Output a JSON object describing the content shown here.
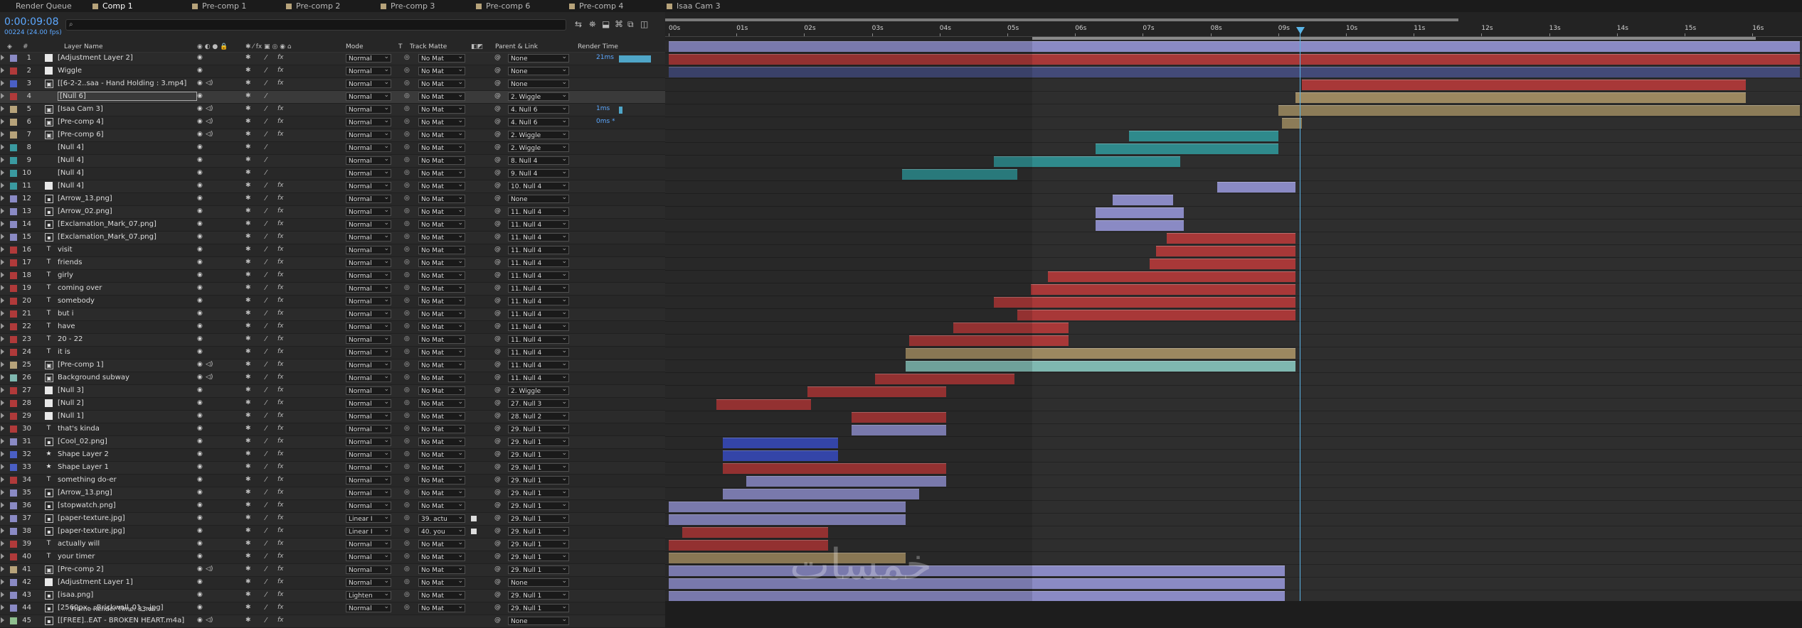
{
  "tabs": [
    {
      "label": "Render Queue",
      "color": "",
      "active": false
    },
    {
      "label": "Comp 1",
      "color": "#b7a37a",
      "active": true
    },
    {
      "label": "Pre-comp 1",
      "color": "#b7a37a",
      "active": false
    },
    {
      "label": "Pre-comp 2",
      "color": "#b7a37a",
      "active": false
    },
    {
      "label": "Pre-comp 3",
      "color": "#b7a37a",
      "active": false
    },
    {
      "label": "Pre-comp 6",
      "color": "#b7a37a",
      "active": false
    },
    {
      "label": "Pre-comp 4",
      "color": "#b7a37a",
      "active": false
    },
    {
      "label": "Isaa Cam 3",
      "color": "#b7a37a",
      "active": false
    }
  ],
  "timecode": "0:00:09:08",
  "frame_info": "00224 (24.00 fps)",
  "search": {
    "placeholder": "",
    "icon": "search-icon"
  },
  "columns": {
    "layer_name": "Layer Name",
    "mode": "Mode",
    "t": "T",
    "track_matte": "Track Matte",
    "parent": "Parent & Link",
    "render_time": "Render Time"
  },
  "ruler": [
    "00s",
    "01s",
    "02s",
    "03s",
    "04s",
    "05s",
    "06s",
    "07s",
    "08s",
    "09s",
    "10s",
    "11s",
    "12s",
    "13s",
    "14s",
    "15s",
    "16s"
  ],
  "layers": [
    {
      "n": "1",
      "color": "#8a8ac4",
      "type": "solid",
      "name": "[Adjustment Layer 2]",
      "mode": "Normal",
      "matte": "No Mat",
      "parent": "None",
      "rt": "21ms",
      "rtbar": 0.1
    },
    {
      "n": "2",
      "color": "#b03a3a",
      "type": "solid",
      "name": "Wiggle",
      "mode": "Normal",
      "matte": "No Mat",
      "parent": "None"
    },
    {
      "n": "3",
      "color": "#4a5fc4",
      "type": "comp",
      "name": "[[6-2-2..saa - Hand Holding : 3.mp4]",
      "mode": "Normal",
      "matte": "No Mat",
      "parent": "None"
    },
    {
      "n": "4",
      "color": "#b03a3a",
      "type": "none",
      "name": "[Null 6]",
      "mode": "Normal",
      "matte": "No Mat",
      "parent": "2. Wiggle",
      "selected": true
    },
    {
      "n": "5",
      "color": "#b7a37a",
      "type": "comp",
      "name": "[Isaa Cam 3]",
      "mode": "Normal",
      "matte": "No Mat",
      "parent": "4. Null 6",
      "rt": "1ms",
      "rtbar": 0.01
    },
    {
      "n": "6",
      "color": "#b7a37a",
      "type": "comp",
      "name": "[Pre-comp 4]",
      "mode": "Normal",
      "matte": "No Mat",
      "parent": "4. Null 6",
      "rt": "0ms *"
    },
    {
      "n": "7",
      "color": "#b7a37a",
      "type": "comp",
      "name": "[Pre-comp 6]",
      "mode": "Normal",
      "matte": "No Mat",
      "parent": "2. Wiggle"
    },
    {
      "n": "8",
      "color": "#3a9aa0",
      "type": "none",
      "name": "[Null 4]",
      "mode": "Normal",
      "matte": "No Mat",
      "parent": "2. Wiggle"
    },
    {
      "n": "9",
      "color": "#3a9aa0",
      "type": "none",
      "name": "[Null 4]",
      "mode": "Normal",
      "matte": "No Mat",
      "parent": "8. Null 4"
    },
    {
      "n": "10",
      "color": "#3a9aa0",
      "type": "none",
      "name": "[Null 4]",
      "mode": "Normal",
      "matte": "No Mat",
      "parent": "9. Null 4"
    },
    {
      "n": "11",
      "color": "#3a9aa0",
      "type": "solid",
      "name": "[Null 4]",
      "mode": "Normal",
      "matte": "No Mat",
      "parent": "10. Null 4"
    },
    {
      "n": "12",
      "color": "#8a8ac4",
      "type": "file",
      "name": "[Arrow_13.png]",
      "mode": "Normal",
      "matte": "No Mat",
      "parent": "None"
    },
    {
      "n": "13",
      "color": "#8a8ac4",
      "type": "file",
      "name": "[Arrow_02.png]",
      "mode": "Normal",
      "matte": "No Mat",
      "parent": "11. Null 4"
    },
    {
      "n": "14",
      "color": "#8a8ac4",
      "type": "file",
      "name": "[Exclamation_Mark_07.png]",
      "mode": "Normal",
      "matte": "No Mat",
      "parent": "11. Null 4"
    },
    {
      "n": "15",
      "color": "#8a8ac4",
      "type": "file",
      "name": "[Exclamation_Mark_07.png]",
      "mode": "Normal",
      "matte": "No Mat",
      "parent": "11. Null 4"
    },
    {
      "n": "16",
      "color": "#b03a3a",
      "type": "text",
      "name": "visit",
      "mode": "Normal",
      "matte": "No Mat",
      "parent": "11. Null 4"
    },
    {
      "n": "17",
      "color": "#b03a3a",
      "type": "text",
      "name": "friends",
      "mode": "Normal",
      "matte": "No Mat",
      "parent": "11. Null 4"
    },
    {
      "n": "18",
      "color": "#b03a3a",
      "type": "text",
      "name": "girly",
      "mode": "Normal",
      "matte": "No Mat",
      "parent": "11. Null 4"
    },
    {
      "n": "19",
      "color": "#b03a3a",
      "type": "text",
      "name": "coming over",
      "mode": "Normal",
      "matte": "No Mat",
      "parent": "11. Null 4"
    },
    {
      "n": "20",
      "color": "#b03a3a",
      "type": "text",
      "name": "somebody",
      "mode": "Normal",
      "matte": "No Mat",
      "parent": "11. Null 4"
    },
    {
      "n": "21",
      "color": "#b03a3a",
      "type": "text",
      "name": "but i",
      "mode": "Normal",
      "matte": "No Mat",
      "parent": "11. Null 4"
    },
    {
      "n": "22",
      "color": "#b03a3a",
      "type": "text",
      "name": "have",
      "mode": "Normal",
      "matte": "No Mat",
      "parent": "11. Null 4"
    },
    {
      "n": "23",
      "color": "#b03a3a",
      "type": "text",
      "name": "20 - 22",
      "mode": "Normal",
      "matte": "No Mat",
      "parent": "11. Null 4"
    },
    {
      "n": "24",
      "color": "#b03a3a",
      "type": "text",
      "name": "it is",
      "mode": "Normal",
      "matte": "No Mat",
      "parent": "11. Null 4"
    },
    {
      "n": "25",
      "color": "#b7a37a",
      "type": "comp",
      "name": "[Pre-comp 1]",
      "mode": "Normal",
      "matte": "No Mat",
      "parent": "11. Null 4"
    },
    {
      "n": "26",
      "color": "#7fb8b0",
      "type": "comp",
      "name": "Background subway",
      "mode": "Normal",
      "matte": "No Mat",
      "parent": "11. Null 4"
    },
    {
      "n": "27",
      "color": "#b03a3a",
      "type": "solid",
      "name": "[Null 3]",
      "mode": "Normal",
      "matte": "No Mat",
      "parent": "2. Wiggle"
    },
    {
      "n": "28",
      "color": "#b03a3a",
      "type": "solid",
      "name": "[Null 2]",
      "mode": "Normal",
      "matte": "No Mat",
      "parent": "27. Null 3"
    },
    {
      "n": "29",
      "color": "#b03a3a",
      "type": "solid",
      "name": "[Null 1]",
      "mode": "Normal",
      "matte": "No Mat",
      "parent": "28. Null 2"
    },
    {
      "n": "30",
      "color": "#b03a3a",
      "type": "text",
      "name": "that's kinda",
      "mode": "Normal",
      "matte": "No Mat",
      "parent": "29. Null 1"
    },
    {
      "n": "31",
      "color": "#8a8ac4",
      "type": "file",
      "name": "[Cool_02.png]",
      "mode": "Normal",
      "matte": "No Mat",
      "parent": "29. Null 1"
    },
    {
      "n": "32",
      "color": "#4a5fc4",
      "type": "shape",
      "name": "Shape Layer 2",
      "mode": "Normal",
      "matte": "No Mat",
      "parent": "29. Null 1"
    },
    {
      "n": "33",
      "color": "#4a5fc4",
      "type": "shape",
      "name": "Shape Layer 1",
      "mode": "Normal",
      "matte": "No Mat",
      "parent": "29. Null 1"
    },
    {
      "n": "34",
      "color": "#b03a3a",
      "type": "text",
      "name": "something do-er",
      "mode": "Normal",
      "matte": "No Mat",
      "parent": "29. Null 1"
    },
    {
      "n": "35",
      "color": "#8a8ac4",
      "type": "file",
      "name": "[Arrow_13.png]",
      "mode": "Normal",
      "matte": "No Mat",
      "parent": "29. Null 1"
    },
    {
      "n": "36",
      "color": "#8a8ac4",
      "type": "file",
      "name": "[stopwatch.png]",
      "mode": "Normal",
      "matte": "No Mat",
      "parent": "29. Null 1"
    },
    {
      "n": "37",
      "color": "#8a8ac4",
      "type": "file",
      "name": "[paper-texture.jpg]",
      "mode": "Linear I",
      "matte": "39. actu",
      "parent": "29. Null 1",
      "tm": true
    },
    {
      "n": "38",
      "color": "#8a8ac4",
      "type": "file",
      "name": "[paper-texture.jpg]",
      "mode": "Linear I",
      "matte": "40. you",
      "parent": "29. Null 1",
      "tm": true
    },
    {
      "n": "39",
      "color": "#b03a3a",
      "type": "text",
      "name": "actually will",
      "mode": "Normal",
      "matte": "No Mat",
      "parent": "29. Null 1"
    },
    {
      "n": "40",
      "color": "#b03a3a",
      "type": "text",
      "name": "your timer",
      "mode": "Normal",
      "matte": "No Mat",
      "parent": "29. Null 1"
    },
    {
      "n": "41",
      "color": "#b7a37a",
      "type": "comp",
      "name": "[Pre-comp 2]",
      "mode": "Normal",
      "matte": "No Mat",
      "parent": "29. Null 1"
    },
    {
      "n": "42",
      "color": "#8a8ac4",
      "type": "solid",
      "name": "[Adjustment Layer 1]",
      "mode": "Normal",
      "matte": "No Mat",
      "parent": "None"
    },
    {
      "n": "43",
      "color": "#8a8ac4",
      "type": "file",
      "name": "[isaa.png]",
      "mode": "Lighten",
      "matte": "No Mat",
      "parent": "29. Null 1"
    },
    {
      "n": "44",
      "color": "#8a8ac4",
      "type": "file",
      "name": "[2560px-...Brickwall_01_-.jpg]",
      "mode": "Normal",
      "matte": "No Mat",
      "parent": "29. Null 1"
    },
    {
      "n": "45",
      "color": "#8fbf8f",
      "type": "file",
      "name": "[[FREE]..EAT - BROKEN HEART.m4a]",
      "mode": "",
      "matte": "",
      "parent": "None"
    }
  ],
  "bars": [
    {
      "row": 0,
      "start": 0.0,
      "end": 16.7,
      "color": "#8a8ac4"
    },
    {
      "row": 1,
      "start": 0.0,
      "end": 16.7,
      "color": "#a83838"
    },
    {
      "row": 2,
      "start": 0.0,
      "end": 16.7,
      "color": "#434a78"
    },
    {
      "row": 3,
      "start": 9.35,
      "end": 15.9,
      "color": "#a83838"
    },
    {
      "row": 4,
      "start": 9.25,
      "end": 15.9,
      "color": "#9c8860"
    },
    {
      "row": 5,
      "start": 9.0,
      "end": 16.7,
      "color": "#8c7c58"
    },
    {
      "row": 6,
      "start": 9.05,
      "end": 9.35,
      "color": "#8c7c58"
    },
    {
      "row": 7,
      "start": 6.8,
      "end": 9.0,
      "color": "#2f8a8c"
    },
    {
      "row": 8,
      "start": 6.3,
      "end": 9.0,
      "color": "#2f8a8c"
    },
    {
      "row": 9,
      "start": 4.8,
      "end": 7.55,
      "color": "#2f8a8c"
    },
    {
      "row": 10,
      "start": 3.45,
      "end": 5.15,
      "color": "#2f8a8c"
    },
    {
      "row": 11,
      "start": 8.1,
      "end": 9.25,
      "color": "#8a8ac4"
    },
    {
      "row": 12,
      "start": 6.55,
      "end": 7.45,
      "color": "#8a8ac4"
    },
    {
      "row": 13,
      "start": 6.3,
      "end": 7.6,
      "color": "#8a8ac4"
    },
    {
      "row": 14,
      "start": 6.3,
      "end": 7.6,
      "color": "#8a8ac4"
    },
    {
      "row": 15,
      "start": 7.35,
      "end": 9.25,
      "color": "#a83838"
    },
    {
      "row": 16,
      "start": 7.2,
      "end": 9.25,
      "color": "#a83838"
    },
    {
      "row": 17,
      "start": 7.1,
      "end": 9.25,
      "color": "#a83838"
    },
    {
      "row": 18,
      "start": 5.6,
      "end": 9.25,
      "color": "#a83838"
    },
    {
      "row": 19,
      "start": 5.35,
      "end": 9.25,
      "color": "#a83838"
    },
    {
      "row": 20,
      "start": 4.8,
      "end": 9.25,
      "color": "#a83838"
    },
    {
      "row": 21,
      "start": 5.15,
      "end": 9.25,
      "color": "#a83838"
    },
    {
      "row": 22,
      "start": 4.2,
      "end": 5.9,
      "color": "#a83838"
    },
    {
      "row": 23,
      "start": 3.55,
      "end": 5.9,
      "color": "#a83838"
    },
    {
      "row": 24,
      "start": 3.5,
      "end": 9.25,
      "color": "#9c8860"
    },
    {
      "row": 25,
      "start": 3.5,
      "end": 9.25,
      "color": "#7fb8b0"
    },
    {
      "row": 26,
      "start": 3.05,
      "end": 5.1,
      "color": "#a83838"
    },
    {
      "row": 27,
      "start": 2.05,
      "end": 4.1,
      "color": "#a83838"
    },
    {
      "row": 28,
      "start": 0.7,
      "end": 2.1,
      "color": "#a83838"
    },
    {
      "row": 29,
      "start": 2.7,
      "end": 4.1,
      "color": "#a83838"
    },
    {
      "row": 30,
      "start": 2.7,
      "end": 4.1,
      "color": "#8a8ac4"
    },
    {
      "row": 31,
      "start": 0.8,
      "end": 2.5,
      "color": "#3c4fc0"
    },
    {
      "row": 32,
      "start": 0.8,
      "end": 2.5,
      "color": "#3c4fc0"
    },
    {
      "row": 33,
      "start": 0.8,
      "end": 4.1,
      "color": "#a83838"
    },
    {
      "row": 34,
      "start": 1.15,
      "end": 4.1,
      "color": "#8a8ac4"
    },
    {
      "row": 35,
      "start": 0.8,
      "end": 3.7,
      "color": "#8a8ac4"
    },
    {
      "row": 36,
      "start": 0.0,
      "end": 3.5,
      "color": "#8a8ac4"
    },
    {
      "row": 37,
      "start": 0.0,
      "end": 3.5,
      "color": "#8a8ac4"
    },
    {
      "row": 38,
      "start": 0.2,
      "end": 2.35,
      "color": "#a83838"
    },
    {
      "row": 39,
      "start": 0.0,
      "end": 2.35,
      "color": "#a83838"
    },
    {
      "row": 40,
      "start": 0.0,
      "end": 3.5,
      "color": "#9c8860"
    },
    {
      "row": 41,
      "start": 0.0,
      "end": 9.1,
      "color": "#8a8ac4"
    },
    {
      "row": 42,
      "start": 0.0,
      "end": 9.1,
      "color": "#8a8ac4"
    },
    {
      "row": 43,
      "start": 0.0,
      "end": 9.1,
      "color": "#8a8ac4"
    },
    {
      "row": 44,
      "start": 0.0,
      "end": 16.7,
      "color": "#7a9a7a"
    }
  ],
  "footer": "Frame Render Time: 33ms",
  "watermark": "خمسات"
}
